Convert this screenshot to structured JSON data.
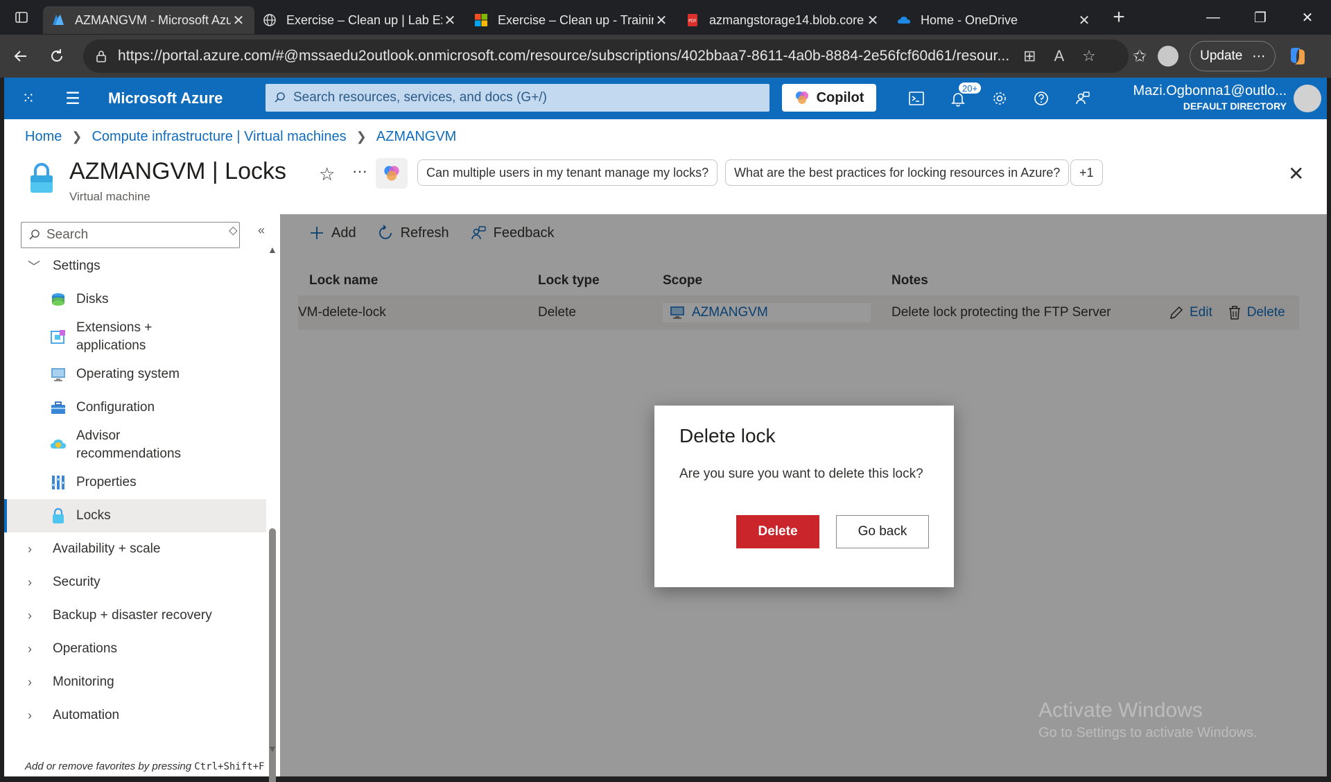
{
  "browser": {
    "tabs": [
      {
        "label": "AZMANGVM - Microsoft Azure",
        "icon": "azure-icon",
        "active": true
      },
      {
        "label": "Exercise – Clean up | Lab Exercise",
        "icon": "globe-icon",
        "active": false
      },
      {
        "label": "Exercise – Clean up - Training",
        "icon": "microsoft-icon",
        "active": false
      },
      {
        "label": "azmangstorage14.blob.core",
        "icon": "pdf-icon",
        "active": false
      },
      {
        "label": "Home - OneDrive",
        "icon": "onedrive-icon",
        "active": false
      }
    ],
    "url": "https://portal.azure.com/#@mssaedu2outlook.onmicrosoft.com/resource/subscriptions/402bbaa7-8611-4a0b-8884-2e56fcf60d61/resour...",
    "update_label": "Update"
  },
  "azure": {
    "brand": "Microsoft Azure",
    "search_placeholder": "Search resources, services, and docs (G+/)",
    "copilot_label": "Copilot",
    "notifications_badge": "20+",
    "account_name": "Mazi.Ogbonna1@outlo...",
    "account_directory": "DEFAULT DIRECTORY"
  },
  "breadcrumb": [
    "Home",
    "Compute infrastructure | Virtual machines",
    "AZMANGVM"
  ],
  "title": {
    "main": "AZMANGVM | Locks",
    "subtitle": "Virtual machine",
    "chips": [
      "Can multiple users in my tenant manage my locks?",
      "What are the best practices for locking resources in Azure?",
      "+1"
    ]
  },
  "nav": {
    "search_placeholder": "Search",
    "settings_label": "Settings",
    "children": [
      {
        "label": "Disks",
        "icon": "disks-icon"
      },
      {
        "label": "Extensions + applications",
        "icon": "extensions-icon"
      },
      {
        "label": "Operating system",
        "icon": "monitor-icon"
      },
      {
        "label": "Configuration",
        "icon": "toolbox-icon"
      },
      {
        "label": "Advisor recommendations",
        "icon": "advisor-icon"
      },
      {
        "label": "Properties",
        "icon": "properties-icon"
      },
      {
        "label": "Locks",
        "icon": "lock-icon",
        "selected": true
      }
    ],
    "sections": [
      "Availability + scale",
      "Security",
      "Backup + disaster recovery",
      "Operations",
      "Monitoring",
      "Automation"
    ],
    "hint_text": "Add or remove favorites by pressing",
    "hint_keys": "Ctrl+Shift+F"
  },
  "toolbar": {
    "add": "Add",
    "refresh": "Refresh",
    "feedback": "Feedback"
  },
  "table": {
    "headers": [
      "Lock name",
      "Lock type",
      "Scope",
      "Notes"
    ],
    "rows": [
      {
        "name": "VM-delete-lock",
        "type": "Delete",
        "scope": "AZMANGVM",
        "notes": "Delete lock protecting the FTP Server",
        "edit": "Edit",
        "delete": "Delete"
      }
    ]
  },
  "dialog": {
    "title": "Delete lock",
    "message": "Are you sure you want to delete this lock?",
    "confirm": "Delete",
    "cancel": "Go back"
  },
  "watermark": {
    "line1": "Activate Windows",
    "line2": "Go to Settings to activate Windows."
  },
  "colors": {
    "azure_blue": "#0f6cbd",
    "danger": "#c9252b"
  }
}
